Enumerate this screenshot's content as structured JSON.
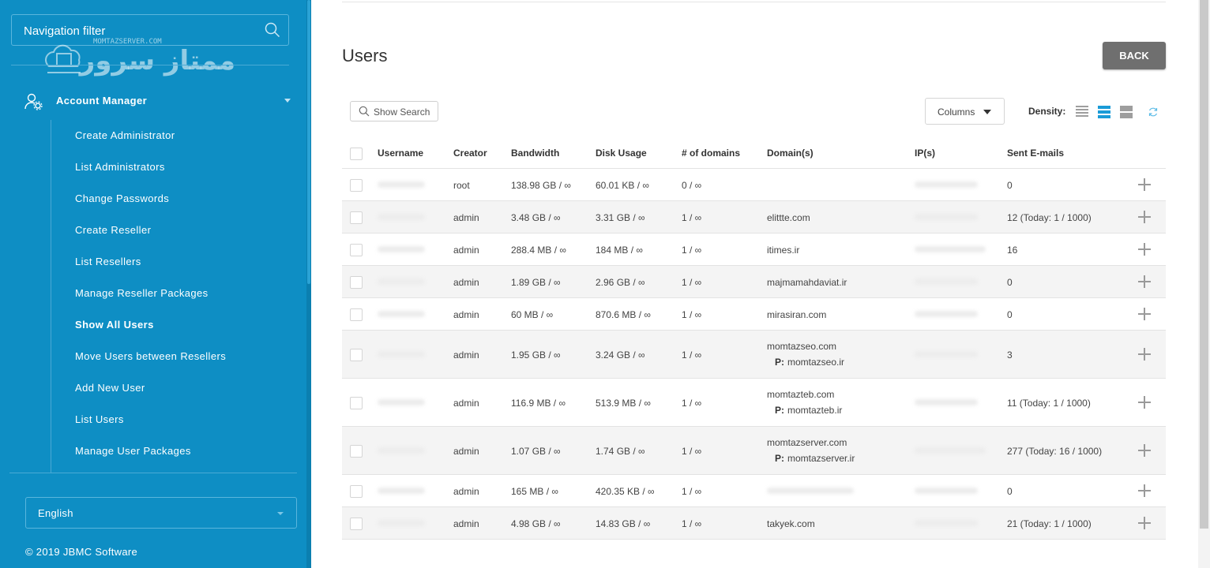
{
  "sidebar": {
    "filter_placeholder": "Navigation filter",
    "logo": {
      "brand_text": "ممتاز سرور",
      "site_text": "MOMTAZSERVER.COM"
    },
    "section_label": "Account Manager",
    "items": [
      {
        "label": "Create Administrator",
        "active": false
      },
      {
        "label": "List Administrators",
        "active": false
      },
      {
        "label": "Change Passwords",
        "active": false
      },
      {
        "label": "Create Reseller",
        "active": false
      },
      {
        "label": "List Resellers",
        "active": false
      },
      {
        "label": "Manage Reseller Packages",
        "active": false
      },
      {
        "label": "Show All Users",
        "active": true
      },
      {
        "label": "Move Users between Resellers",
        "active": false
      },
      {
        "label": "Add New User",
        "active": false
      },
      {
        "label": "List Users",
        "active": false
      },
      {
        "label": "Manage User Packages",
        "active": false
      }
    ],
    "language": "English",
    "copyright": "© 2019 JBMC Software"
  },
  "main": {
    "title": "Users",
    "back_label": "BACK",
    "show_search_label": "Show Search",
    "columns_label": "Columns",
    "density_label": "Density:",
    "density_selected": "normal"
  },
  "table": {
    "headers": {
      "username": "Username",
      "creator": "Creator",
      "bandwidth": "Bandwidth",
      "disk": "Disk Usage",
      "domains_count": "# of domains",
      "domains": "Domain(s)",
      "ips": "IP(s)",
      "emails": "Sent E-mails"
    },
    "rows": [
      {
        "creator": "root",
        "bandwidth": "138.98 GB / ∞",
        "disk": "60.01 KB / ∞",
        "domains_count": "0 / ∞",
        "domain": "",
        "pointer": "",
        "emails": "0"
      },
      {
        "creator": "admin",
        "bandwidth": "3.48 GB / ∞",
        "disk": "3.31 GB / ∞",
        "domains_count": "1 / ∞",
        "domain": "elittte.com",
        "pointer": "",
        "emails": "12 (Today: 1 / 1000)"
      },
      {
        "creator": "admin",
        "bandwidth": "288.4 MB / ∞",
        "disk": "184 MB / ∞",
        "domains_count": "1 / ∞",
        "domain": "itimes.ir",
        "pointer": "",
        "emails": "16"
      },
      {
        "creator": "admin",
        "bandwidth": "1.89 GB / ∞",
        "disk": "2.96 GB / ∞",
        "domains_count": "1 / ∞",
        "domain": "majmamahdaviat.ir",
        "pointer": "",
        "emails": "0"
      },
      {
        "creator": "admin",
        "bandwidth": "60 MB / ∞",
        "disk": "870.6 MB / ∞",
        "domains_count": "1 / ∞",
        "domain": "mirasiran.com",
        "pointer": "",
        "emails": "0"
      },
      {
        "creator": "admin",
        "bandwidth": "1.95 GB / ∞",
        "disk": "3.24 GB / ∞",
        "domains_count": "1 / ∞",
        "domain": "momtazseo.com",
        "pointer": "momtazseo.ir",
        "emails": "3"
      },
      {
        "creator": "admin",
        "bandwidth": "116.9 MB / ∞",
        "disk": "513.9 MB / ∞",
        "domains_count": "1 / ∞",
        "domain": "momtazteb.com",
        "pointer": "momtazteb.ir",
        "emails": "11 (Today: 1 / 1000)"
      },
      {
        "creator": "admin",
        "bandwidth": "1.07 GB / ∞",
        "disk": "1.74 GB / ∞",
        "domains_count": "1 / ∞",
        "domain": "momtazserver.com",
        "pointer": "momtazserver.ir",
        "emails": "277 (Today: 16 / 1000)"
      },
      {
        "creator": "admin",
        "bandwidth": "165 MB / ∞",
        "disk": "420.35 KB / ∞",
        "domains_count": "1 / ∞",
        "domain": "",
        "pointer": "",
        "emails": "0"
      },
      {
        "creator": "admin",
        "bandwidth": "4.98 GB / ∞",
        "disk": "14.83 GB / ∞",
        "domains_count": "1 / ∞",
        "domain": "takyek.com",
        "pointer": "",
        "emails": "21 (Today: 1 / 1000)"
      }
    ],
    "pointer_prefix": "P:"
  },
  "colors": {
    "sidebar_bg": "#0e8ec4",
    "back_button": "#6f6f6f",
    "density_active": "#1a9bd7"
  }
}
